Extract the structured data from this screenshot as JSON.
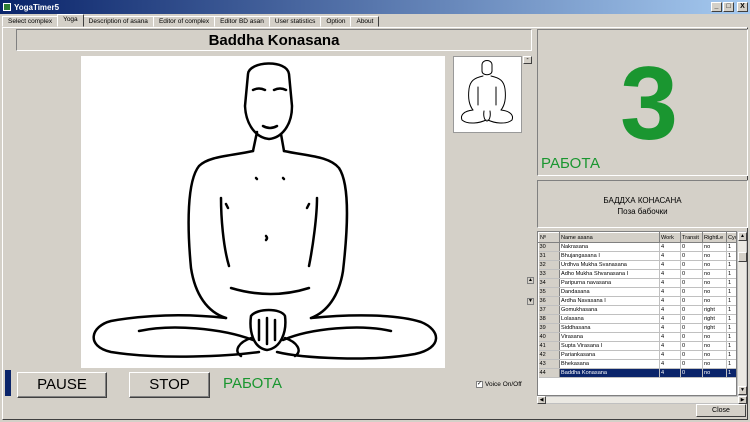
{
  "window": {
    "title": "YogaTimer5",
    "min": "_",
    "max": "□",
    "close": "X"
  },
  "tabs": [
    "Select complex",
    "Yoga",
    "Description of asana",
    "Editor of complex",
    "Editor BD asan",
    "User statistics",
    "Option",
    "About"
  ],
  "asana": {
    "title": "Baddha Konasana",
    "ru_name": "БАДДХА КОНАСАНА",
    "ru_desc": "Поза бабочки"
  },
  "zoom": {
    "plus": "+",
    "minus": "-"
  },
  "counter": {
    "value": "3",
    "label": "РАБОТА"
  },
  "controls": {
    "pause": "PAUSE",
    "stop": "STOP",
    "status": "РАБОТА",
    "voice": "Voice On/Off",
    "voice_checked": true,
    "close": "Close"
  },
  "colors": {
    "accent": "#1a9630",
    "selection": "#0a246a"
  },
  "grid": {
    "columns": [
      "Nº",
      "Name asana",
      "Work",
      "Transit",
      "RightLe",
      "Cyc"
    ],
    "rows": [
      [
        "30",
        "Nakrasana",
        "4",
        "0",
        "no",
        "1"
      ],
      [
        "31",
        "Bhujangasana I",
        "4",
        "0",
        "no",
        "1"
      ],
      [
        "32",
        "Urdhva Mukha Svanasana",
        "4",
        "0",
        "no",
        "1"
      ],
      [
        "33",
        "Adho Mukha Shvanasana I",
        "4",
        "0",
        "no",
        "1"
      ],
      [
        "34",
        "Paripurna navasana",
        "4",
        "0",
        "no",
        "1"
      ],
      [
        "35",
        "Dandasana",
        "4",
        "0",
        "no",
        "1"
      ],
      [
        "36",
        "Ardha Navasana I",
        "4",
        "0",
        "no",
        "1"
      ],
      [
        "37",
        "Gomukhasana",
        "4",
        "0",
        "right",
        "1"
      ],
      [
        "38",
        "Lolasana",
        "4",
        "0",
        "right",
        "1"
      ],
      [
        "39",
        "Siddhasana",
        "4",
        "0",
        "right",
        "1"
      ],
      [
        "40",
        "Virasana",
        "4",
        "0",
        "no",
        "1"
      ],
      [
        "41",
        "Supta Virasana I",
        "4",
        "0",
        "no",
        "1"
      ],
      [
        "42",
        "Pariankasana",
        "4",
        "0",
        "no",
        "1"
      ],
      [
        "43",
        "Bhekasana",
        "4",
        "0",
        "no",
        "1"
      ],
      [
        "44",
        "Baddha Konasana",
        "4",
        "0",
        "no",
        "1"
      ]
    ],
    "selected_index": 14
  }
}
